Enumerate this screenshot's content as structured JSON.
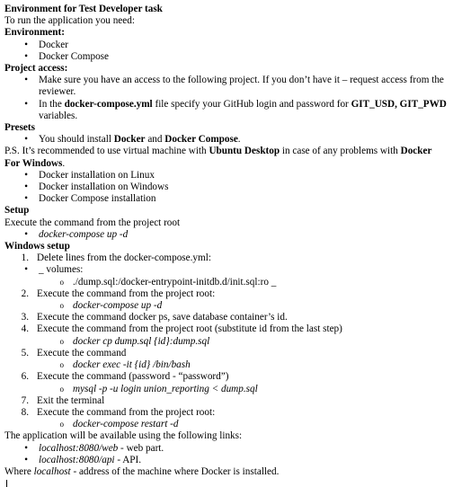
{
  "title": "Environment for Test Developer task",
  "intro": "To run the application you need:",
  "environment": {
    "heading": "Environment:",
    "items": [
      "Docker",
      "Docker Compose"
    ]
  },
  "project_access": {
    "heading": "Project access:",
    "item1": "Make sure you have an access to the following project. If you don’t have it – request access from the reviewer.",
    "item2_pre": "In the ",
    "item2_file": "docker-compose.yml",
    "item2_mid": " file specify your GitHub login and password for ",
    "item2_vars": "GIT_USD, GIT_PWD",
    "item2_post": " variables."
  },
  "presets": {
    "heading": "Presets",
    "item_pre": "You should install ",
    "item_docker": "Docker",
    "item_and": " and ",
    "item_compose": "Docker Compose",
    "item_post": "."
  },
  "ps": {
    "pre": "P.S. It’s recommended to use virtual machine with ",
    "os": "Ubuntu Desktop",
    "mid": " in case of any problems with ",
    "docker_for_windows": "Docker For Windows",
    "post": "."
  },
  "install_links": [
    "Docker installation on Linux",
    "Docker installation on Windows",
    "Docker Compose installation"
  ],
  "setup": {
    "heading": "Setup",
    "text": "Execute the command from the project root",
    "command": "docker-compose up -d"
  },
  "windows_setup": {
    "heading": "Windows setup",
    "step1": "Delete lines from the docker-compose.yml:",
    "step1_bullet": "_ volumes:",
    "step1_sub": "./dump.sql:/docker-entrypoint-initdb.d/init.sql:ro _",
    "step2": "Execute the command from the project root:",
    "step2_cmd": "docker-compose up -d",
    "step3": "Execute the command docker ps, save database container’s id.",
    "step4": "Execute the command from the project root (substitute id from the last step)",
    "step4_cmd": "docker cp dump.sql {id}:dump.sql",
    "step5": "Execute the command",
    "step5_cmd": "docker exec -it {id} /bin/bash",
    "step6": "Execute the command (password - “password”)",
    "step6_cmd": "mysql -p -u login union_reporting < dump.sql",
    "step7": "Exit the terminal",
    "step8": "Execute the command from the project root:",
    "step8_cmd": "docker-compose restart -d"
  },
  "availability": {
    "text": "The application will be available using the following links:",
    "web_link": "localhost:8080/web",
    "web_desc": " - web part.",
    "api_link": "localhost:8080/api",
    "api_desc": " - API."
  },
  "footer": {
    "pre": "Where ",
    "host": "localhost",
    "post": " - address of the machine where Docker is installed."
  }
}
